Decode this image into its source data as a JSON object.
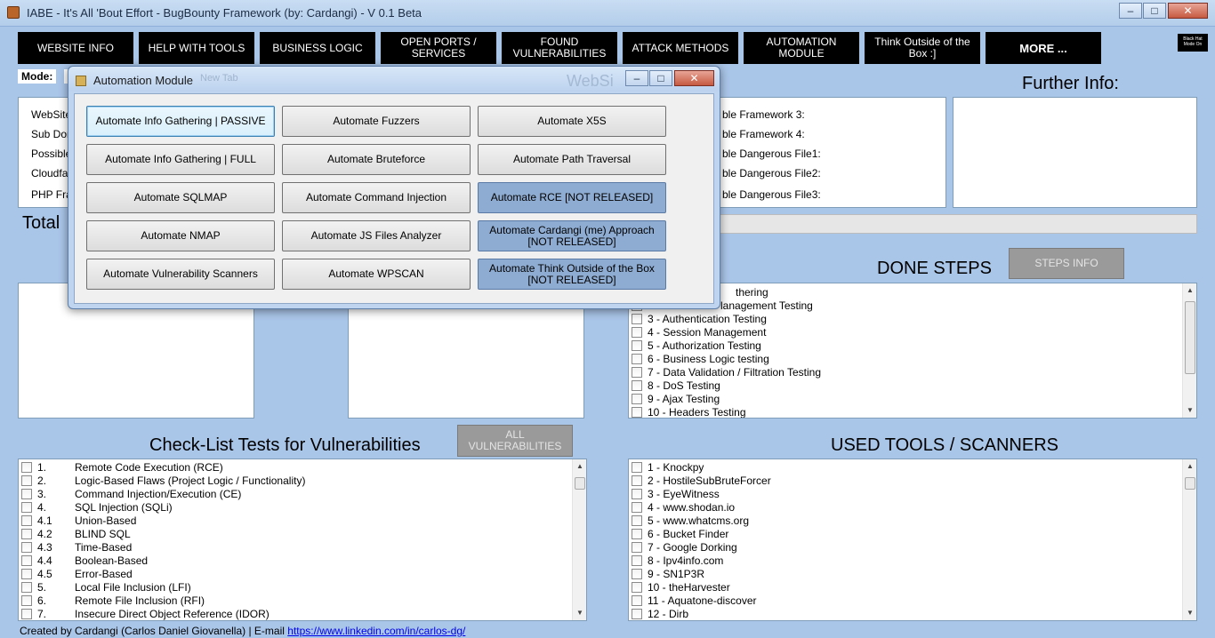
{
  "window": {
    "title": "IABE - It's All 'Bout Effort - BugBounty Framework (by: Cardangi) - V 0.1 Beta",
    "controls": {
      "minimize": "–",
      "maximize": "□",
      "close": "✕"
    }
  },
  "nav": [
    {
      "label": "WEBSITE INFO"
    },
    {
      "label": "HELP WITH TOOLS"
    },
    {
      "label": "BUSINESS LOGIC"
    },
    {
      "label": "OPEN PORTS / SERVICES"
    },
    {
      "label": "FOUND VULNERABILITIES"
    },
    {
      "label": "ATTACK METHODS"
    },
    {
      "label": "AUTOMATION MODULE"
    },
    {
      "label": "Think Outside of the Box :]"
    },
    {
      "label": "MORE ..."
    }
  ],
  "black_hat_button": "Black Hat Mode On",
  "mode": {
    "label": "Mode:"
  },
  "website_info": {
    "left_labels": [
      "WebSite",
      "Sub Dom",
      "Possible",
      "Cloudfar",
      "PHP Fra"
    ],
    "right_labels": [
      "ble Framework 3:",
      "ble Framework 4:",
      "ble Dangerous File1:",
      "ble Dangerous File2:",
      "ble Dangerous File3:"
    ]
  },
  "further_info": {
    "title": "Further Info:"
  },
  "total": {
    "label": "Total"
  },
  "done_steps": {
    "title": "DONE STEPS",
    "info_button": "STEPS INFO",
    "items": [
      "thering",
      "lanagement Testing",
      "3 - Authentication Testing",
      "4 - Session Management",
      "5 - Authorization Testing",
      "6 - Business Logic testing",
      "7 - Data Validation / Filtration Testing",
      "8 - DoS Testing",
      "9 - Ajax Testing",
      "10 - Headers Testing"
    ]
  },
  "checklist": {
    "title": "Check-List Tests for Vulnerabilities",
    "all_button": "ALL VULNERABILITIES",
    "items": [
      {
        "num": "1.",
        "text": "Remote Code Execution (RCE)"
      },
      {
        "num": "2.",
        "text": "Logic-Based Flaws (Project Logic / Functionality)"
      },
      {
        "num": "3.",
        "text": "Command Injection/Execution (CE)"
      },
      {
        "num": "4.",
        "text": "SQL Injection (SQLi)"
      },
      {
        "num": "4.1",
        "text": "Union-Based"
      },
      {
        "num": "4.2",
        "text": "BLIND SQL"
      },
      {
        "num": "4.3",
        "text": "Time-Based"
      },
      {
        "num": "4.4",
        "text": "Boolean-Based"
      },
      {
        "num": "4.5",
        "text": "Error-Based"
      },
      {
        "num": "5.",
        "text": "Local File Inclusion (LFI)"
      },
      {
        "num": "6.",
        "text": "Remote File Inclusion (RFI)"
      },
      {
        "num": "7.",
        "text": "Insecure Direct Object Reference (IDOR)"
      }
    ]
  },
  "tools": {
    "title": "USED TOOLS / SCANNERS",
    "items": [
      "1 - Knockpy",
      "2 - HostileSubBruteForcer",
      "3 - EyeWitness",
      "4 - www.shodan.io",
      "5 - www.whatcms.org",
      "6 - Bucket Finder",
      "7 - Google Dorking",
      "8 - Ipv4info.com",
      "9 - SN1P3R",
      "10 - theHarvester",
      "11 - Aquatone-discover",
      "12 - Dirb"
    ]
  },
  "footer": {
    "text": "Created by Cardangi (Carlos Daniel Giovanella) | E-mail",
    "link": "https://www.linkedin.com/in/carlos-dg/"
  },
  "automation_modal": {
    "title": "Automation Module",
    "ghost_text": "New Tab",
    "ghost_title": "WebSi",
    "buttons": [
      [
        "Automate Info Gathering | PASSIVE",
        "Automate Fuzzers",
        "Automate X5S"
      ],
      [
        "Automate Info Gathering | FULL",
        "Automate Bruteforce",
        "Automate Path Traversal"
      ],
      [
        "Automate SQLMAP",
        "Automate Command Injection",
        "Automate RCE [NOT RELEASED]"
      ],
      [
        "Automate NMAP",
        "Automate JS Files Analyzer",
        "Automate Cardangi (me) Approach [NOT RELEASED]"
      ],
      [
        "Automate Vulnerability Scanners",
        "Automate WPSCAN",
        "Automate Think Outside of the Box [NOT RELEASED]"
      ]
    ]
  }
}
